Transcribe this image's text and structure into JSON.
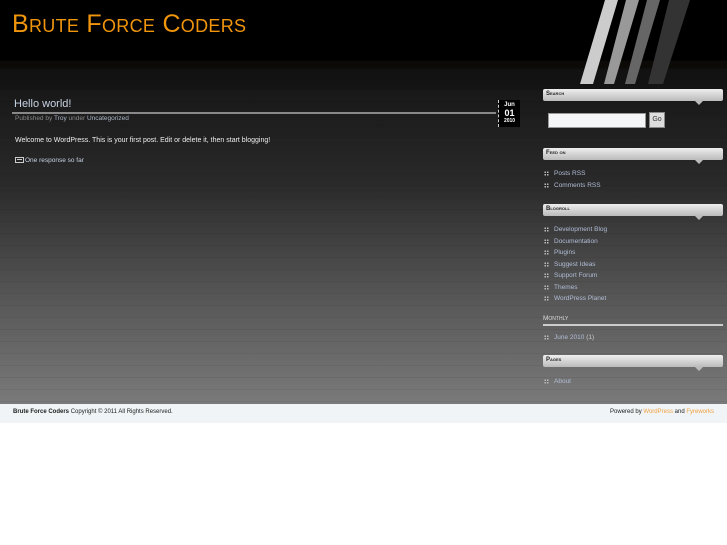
{
  "site": {
    "title": "Brute Force Coders"
  },
  "post": {
    "title": "Hello world!",
    "meta_prefix": "Published by",
    "author": "Troy",
    "meta_mid": "under",
    "category": "Uncategorized",
    "date": {
      "month": "Jun",
      "day": "01",
      "year": "2010"
    },
    "body": "Welcome to WordPress. This is your first post. Edit or delete it, then start blogging!",
    "comments": "One response so far"
  },
  "sidebar": {
    "search": {
      "title": "Search",
      "value": "",
      "button": "Go"
    },
    "feed": {
      "title": "Feed on",
      "items": [
        "Posts RSS",
        "Comments RSS"
      ]
    },
    "blogroll": {
      "title": "Blogroll",
      "items": [
        "Development Blog",
        "Documentation",
        "Plugins",
        "Suggest Ideas",
        "Support Forum",
        "Themes",
        "WordPress Planet"
      ]
    },
    "monthly": {
      "title": "Monthly",
      "items": [
        {
          "label": "June 2010",
          "count": "(1)"
        }
      ]
    },
    "pages": {
      "title": "Pages",
      "items": [
        "About"
      ]
    }
  },
  "footer": {
    "site": "Brute Force Coders",
    "copyright": "Copyright © 2011 All Rights Reserved.",
    "powered": "Powered by",
    "wp": "WordPress",
    "and": "and",
    "theme": "Fyreworks"
  }
}
